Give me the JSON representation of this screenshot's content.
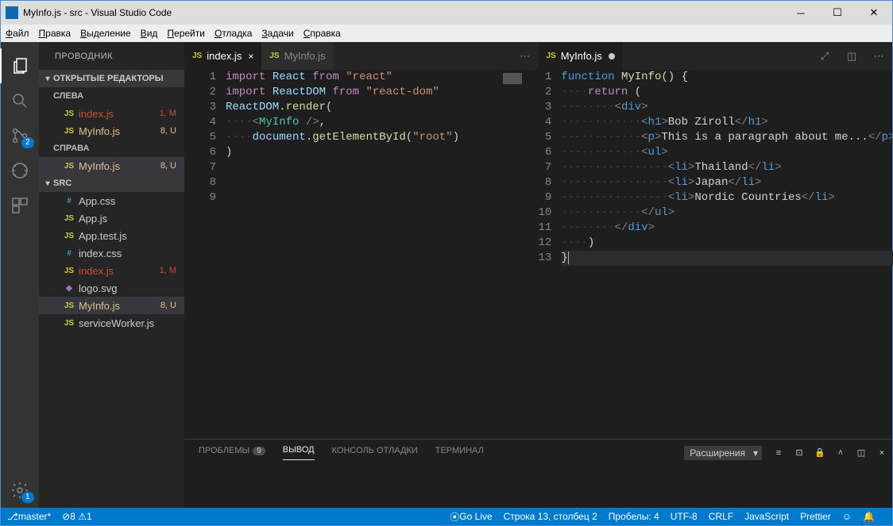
{
  "title": "MyInfo.js - src - Visual Studio Code",
  "menus": [
    "Файл",
    "Правка",
    "Выделение",
    "Вид",
    "Перейти",
    "Отладка",
    "Задачи",
    "Справка"
  ],
  "activity_badge_scm": "2",
  "gear_badge": "1",
  "explorer_title": "ПРОВОДНИК",
  "open_editors": "ОТКРЫТЫЕ РЕДАКТОРЫ",
  "group_left": "СЛЕВА",
  "group_right": "СПРАВА",
  "src_label": "SRC",
  "files_left": [
    {
      "name": "index.js",
      "status": "1, M"
    },
    {
      "name": "MyInfo.js",
      "status": "8, U"
    }
  ],
  "files_right": [
    {
      "name": "MyInfo.js",
      "status": "8, U"
    }
  ],
  "src_files": [
    {
      "name": "App.css",
      "ic": "#",
      "cls": "ic-css",
      "status": ""
    },
    {
      "name": "App.js",
      "ic": "JS",
      "cls": "ic-js",
      "status": ""
    },
    {
      "name": "App.test.js",
      "ic": "JS",
      "cls": "ic-js",
      "status": ""
    },
    {
      "name": "index.css",
      "ic": "#",
      "cls": "ic-css",
      "status": ""
    },
    {
      "name": "index.js",
      "ic": "JS",
      "cls": "ic-js",
      "status": "1, M",
      "mod": "m"
    },
    {
      "name": "logo.svg",
      "ic": "◆",
      "cls": "ic-svg",
      "status": ""
    },
    {
      "name": "MyInfo.js",
      "ic": "JS",
      "cls": "ic-js",
      "status": "8, U",
      "mod": "u",
      "sel": true
    },
    {
      "name": "serviceWorker.js",
      "ic": "JS",
      "cls": "ic-js",
      "status": ""
    }
  ],
  "tab_left1": "index.js",
  "tab_left2": "MyInfo.js",
  "tab_right1": "MyInfo.js",
  "left_code": [
    {
      "n": 1,
      "h": "<span class='kw'>import</span> <span class='var'>React</span> <span class='kw'>from</span> <span class='str'>\"react\"</span>"
    },
    {
      "n": 2,
      "h": "<span class='kw'>import</span> <span class='var'>ReactDOM</span> <span class='kw'>from</span> <span class='str'>\"react-dom\"</span>"
    },
    {
      "n": 3,
      "h": ""
    },
    {
      "n": 4,
      "h": "<span class='var'>ReactDOM</span>.<span class='fn'>render</span>("
    },
    {
      "n": 5,
      "h": "<span class='ws'>····</span><span class='tag'>&lt;</span><span class='cls'>MyInfo</span> <span class='tag'>/&gt;</span>,"
    },
    {
      "n": 6,
      "h": "<span class='ws'>····</span><span class='var'>document</span>.<span class='fn'>getElementById</span>(<span class='str'>\"root\"</span>)"
    },
    {
      "n": 7,
      "h": ")"
    },
    {
      "n": 8,
      "h": ""
    },
    {
      "n": 9,
      "h": ""
    }
  ],
  "right_code": [
    {
      "n": 1,
      "h": "<span class='tagn'>function</span> <span class='fn'>MyInfo</span>() {"
    },
    {
      "n": 2,
      "h": "<span class='ws'>····</span><span class='kw'>return</span> ("
    },
    {
      "n": 3,
      "h": "<span class='ws'>········</span><span class='tag'>&lt;</span><span class='tagn'>div</span><span class='tag'>&gt;</span>"
    },
    {
      "n": 4,
      "h": "<span class='ws'>············</span><span class='tag'>&lt;</span><span class='tagn'>h1</span><span class='tag'>&gt;</span>Bob Ziroll<span class='tag'>&lt;/</span><span class='tagn'>h1</span><span class='tag'>&gt;</span>"
    },
    {
      "n": 5,
      "h": "<span class='ws'>············</span><span class='tag'>&lt;</span><span class='tagn'>p</span><span class='tag'>&gt;</span>This is a paragraph about me...<span class='tag'>&lt;/</span><span class='tagn'>p</span><span class='tag'>&gt;</span>"
    },
    {
      "n": 6,
      "h": "<span class='ws'>············</span><span class='tag'>&lt;</span><span class='tagn'>ul</span><span class='tag'>&gt;</span>"
    },
    {
      "n": 7,
      "h": "<span class='ws'>················</span><span class='tag'>&lt;</span><span class='tagn'>li</span><span class='tag'>&gt;</span>Thailand<span class='tag'>&lt;/</span><span class='tagn'>li</span><span class='tag'>&gt;</span>"
    },
    {
      "n": 8,
      "h": "<span class='ws'>················</span><span class='tag'>&lt;</span><span class='tagn'>li</span><span class='tag'>&gt;</span>Japan<span class='tag'>&lt;/</span><span class='tagn'>li</span><span class='tag'>&gt;</span>"
    },
    {
      "n": 9,
      "h": "<span class='ws'>················</span><span class='tag'>&lt;</span><span class='tagn'>li</span><span class='tag'>&gt;</span>Nordic Countries<span class='tag'>&lt;/</span><span class='tagn'>li</span><span class='tag'>&gt;</span>"
    },
    {
      "n": 10,
      "h": "<span class='ws'>············</span><span class='tag'>&lt;/</span><span class='tagn'>ul</span><span class='tag'>&gt;</span>"
    },
    {
      "n": 11,
      "h": "<span class='ws'>········</span><span class='tag'>&lt;/</span><span class='tagn'>div</span><span class='tag'>&gt;</span>"
    },
    {
      "n": 12,
      "h": "<span class='ws'>····</span>)"
    },
    {
      "n": 13,
      "h": "}<span class='cursor'></span>",
      "cur": true
    }
  ],
  "panel": {
    "problems": "ПРОБЛЕМЫ",
    "problems_n": "9",
    "output": "ВЫВОД",
    "debug": "КОНСОЛЬ ОТЛАДКИ",
    "terminal": "ТЕРМИНАЛ",
    "dropdown": "Расширения"
  },
  "status": {
    "branch": "master*",
    "errors": "8",
    "warnings": "1",
    "golive": "Go Live",
    "pos": "Строка 13, столбец 2",
    "spaces": "Пробелы: 4",
    "enc": "UTF-8",
    "eol": "CRLF",
    "lang": "JavaScript",
    "prettier": "Prettier"
  }
}
